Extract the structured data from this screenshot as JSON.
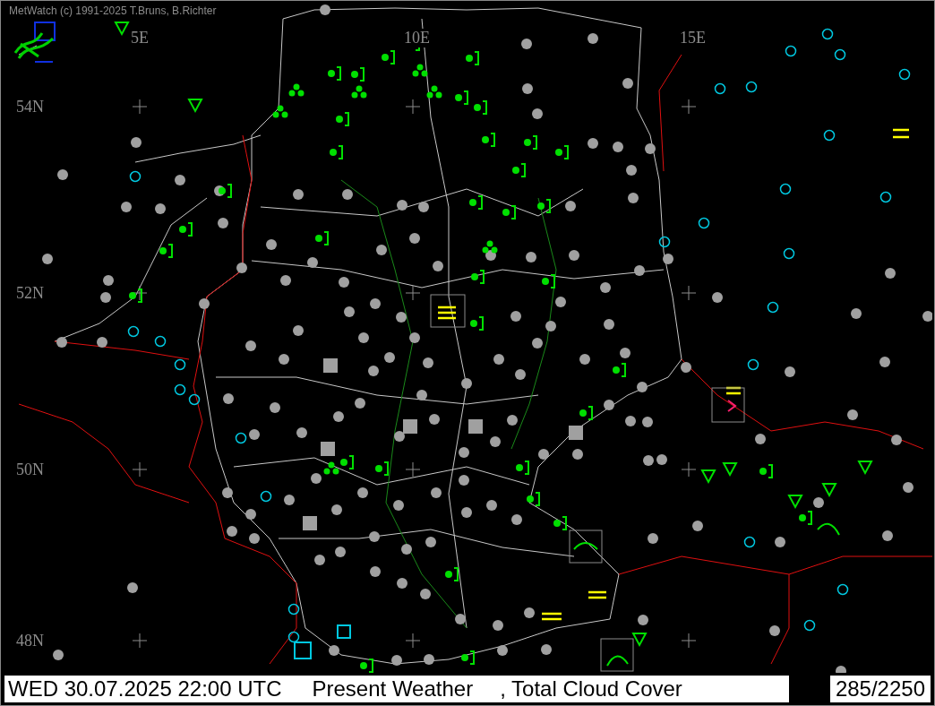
{
  "app_title": "MetWatch  (c) 1991-2025 T.Bruns, B.Richter",
  "map": {
    "longitude_labels": [
      "5E",
      "10E",
      "15E"
    ],
    "latitude_labels": [
      "54N",
      "52N",
      "50N",
      "48N"
    ]
  },
  "status_bar": {
    "datetime": "WED 30.07.2025 22:00 UTC",
    "parameter_1": "Present Weather",
    "parameter_2": ", Total Cloud Cover",
    "station_count": "285/2250"
  }
}
